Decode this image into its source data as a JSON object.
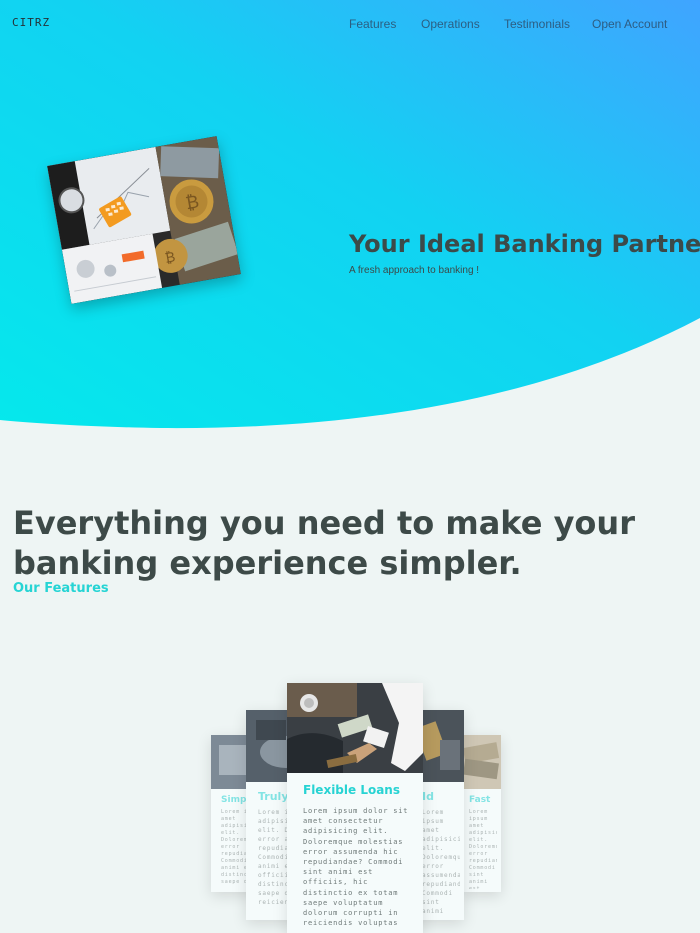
{
  "nav": {
    "logo": "CITRZ",
    "links": [
      "Features",
      "Operations",
      "Testimonials",
      "Open Account"
    ]
  },
  "hero": {
    "title": "Your Ideal Banking Partner",
    "subtitle": "A fresh approach to banking !"
  },
  "features": {
    "heading": "Everything you need to make your banking experience simpler.",
    "label": "Our Features"
  },
  "cards": {
    "center": {
      "title": "Flexible Loans",
      "body": "Lorem ipsum dolor sit amet consectetur adipisicing elit. Doloremque molestias error assumenda hic repudiandae? Commodi sint animi est officiis, hic distinctio ex totam saepe voluptatum dolorum corrupti in reiciendis voluptas"
    },
    "left": {
      "title": "Truly",
      "body": "Lorem ipsum amet adipisicing elit. Doloremque error assumenda repudiandae? Commodi sint animi est officiis distinctio totam saepe dolorum in reiciendis"
    },
    "right": {
      "title": "Id",
      "body": "Lorem ipsum amet adipisicing elit. Doloremque error assumenda repudiandae? Commodi sint animi est officiis distinctio totam saepe dolorum in reiciendis"
    },
    "far_left": {
      "title": "Simple",
      "body": "Lorem ipsum amet adipisicing elit. Doloremque error repudiandae? Commodi sint animi est distinctio saepe dolorum"
    },
    "far_right": {
      "title": "Fast",
      "body": "Lorem ipsum amet adipisicing elit. Doloremque error repudiandae? Commodi sint animi est distinctio saepe dolorum"
    }
  },
  "colors": {
    "accent": "#26d4d4",
    "hero_gradient_start": "#06e6ee",
    "hero_gradient_end": "#3aa8ff",
    "background": "#eef5f4",
    "text_dark": "#3d4a48"
  }
}
